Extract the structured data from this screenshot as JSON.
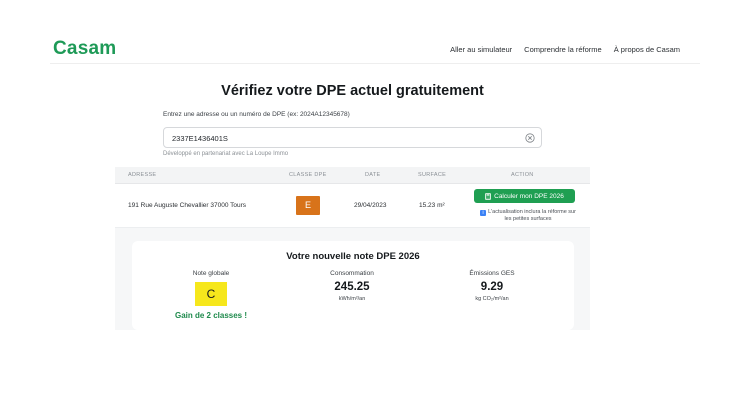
{
  "header": {
    "logo": "Casam",
    "nav": [
      "Aller au simulateur",
      "Comprendre la réforme",
      "À propos de Casam"
    ]
  },
  "main": {
    "title": "Vérifiez votre DPE actuel gratuitement",
    "search": {
      "hint": "Entrez une adresse ou un numéro de DPE (ex: 2024A12345678)",
      "value": "2337E1436401S",
      "placeholder": ""
    },
    "partner": "Développé en partenariat avec La Loupe Immo"
  },
  "table": {
    "headers": [
      "ADRESSE",
      "CLASSE DPE",
      "DATE",
      "SURFACE",
      "ACTION"
    ],
    "row": {
      "address": "191 Rue Auguste Chevallier 37000 Tours",
      "dpe_class": "E",
      "dpe_class_color": "#d8731a",
      "date": "29/04/2023",
      "surface": "15.23 m²",
      "action_label": "Calculer mon DPE 2026",
      "note": "L'actualisation inclura la réforme sur les petites surfaces"
    }
  },
  "result": {
    "title": "Votre nouvelle note DPE 2026",
    "global_label": "Note globale",
    "new_class": "C",
    "new_class_color": "#f6e71c",
    "gain": "Gain de 2 classes !",
    "consumption_label": "Consommation",
    "consumption_value": "245.25",
    "consumption_unit": "kWh/m²/an",
    "ges_label": "Émissions GES",
    "ges_value": "9.29",
    "ges_unit": "kg CO₂/m²/an"
  },
  "colors": {
    "brand": "#1e9a57",
    "button": "#1f9f52",
    "gain": "#1e8a4c"
  }
}
